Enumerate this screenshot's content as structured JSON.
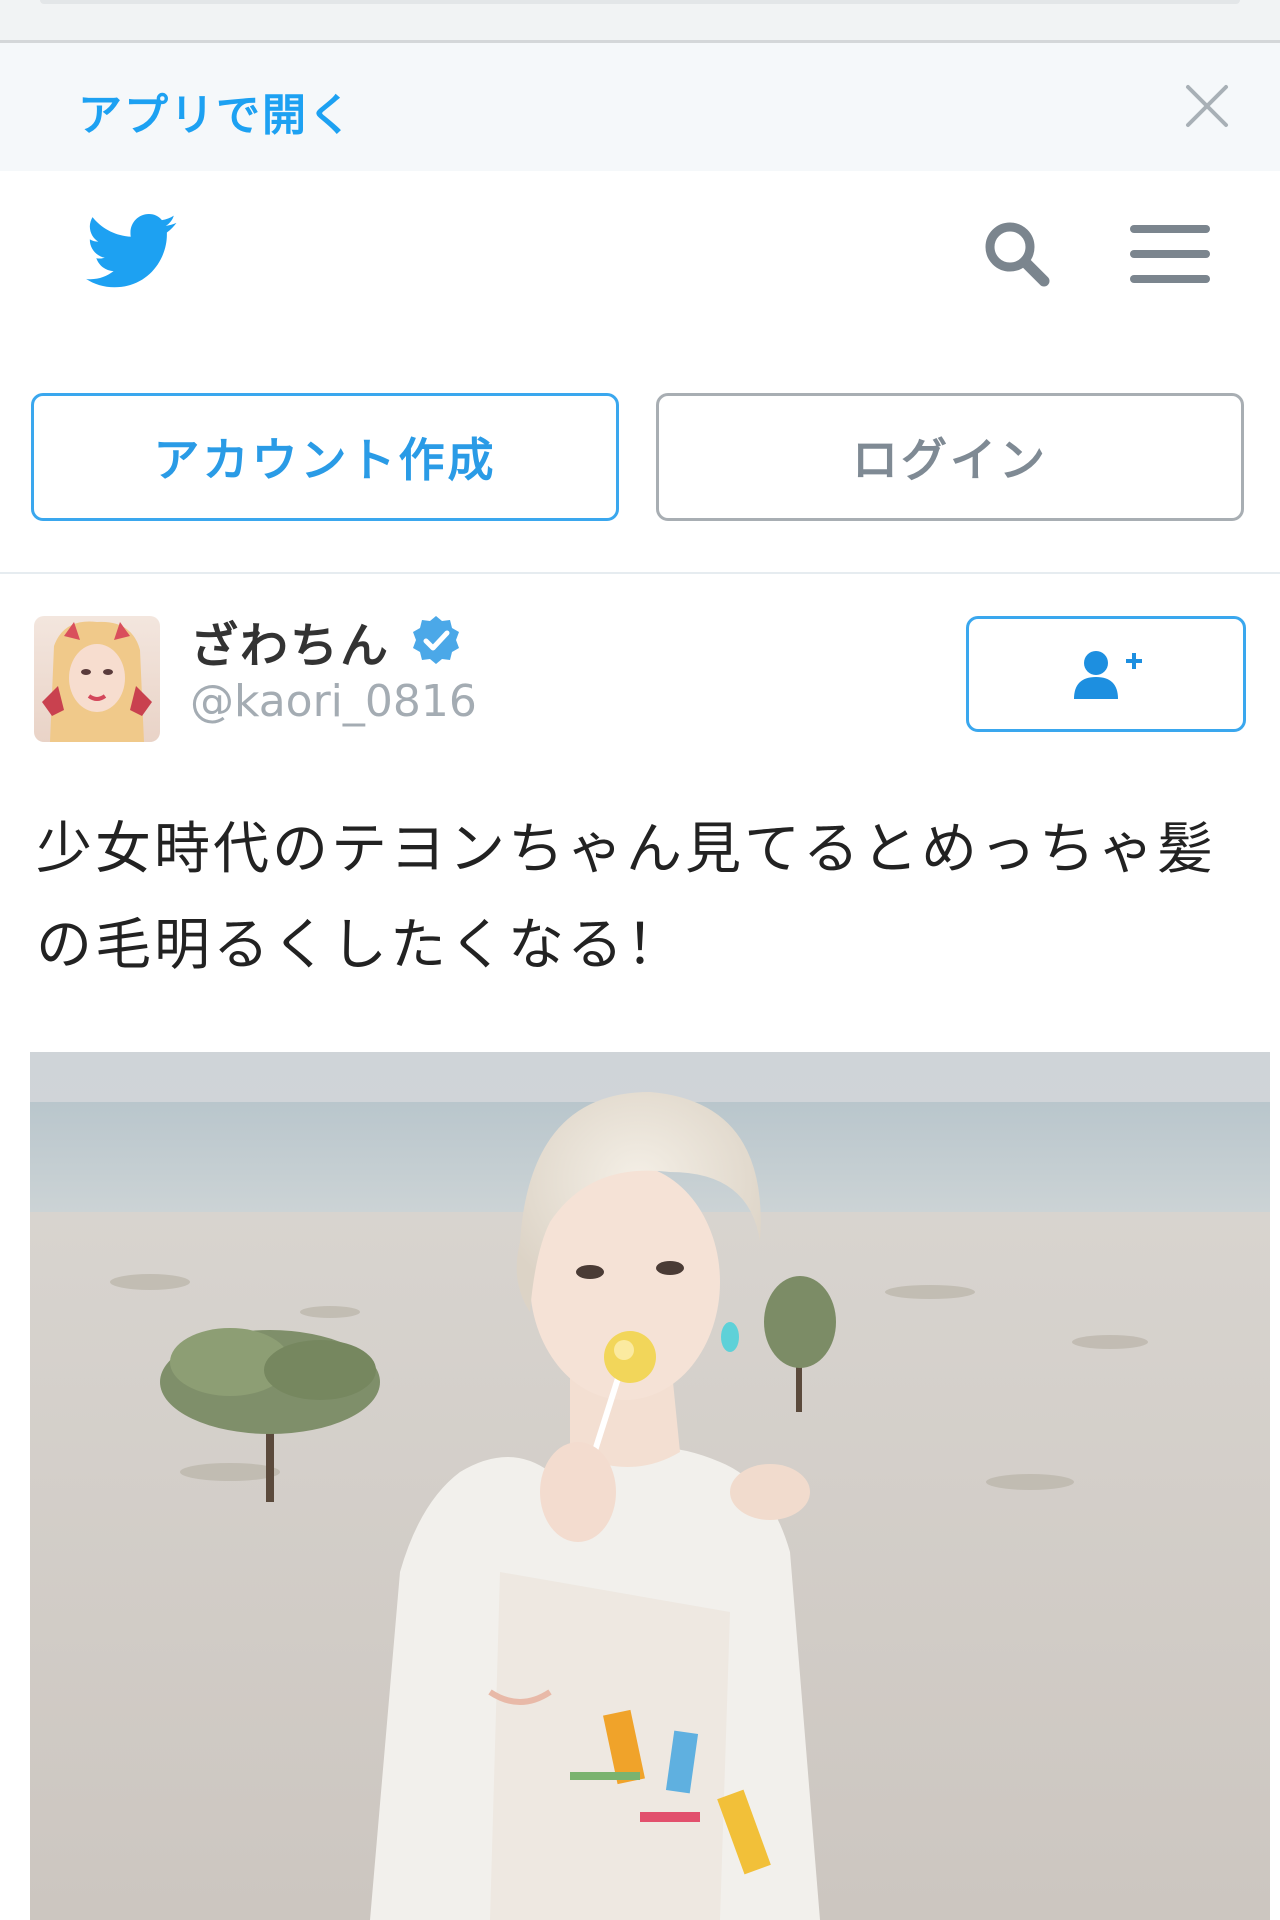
{
  "banner": {
    "open_in_app_label": "アプリで開く",
    "close_icon": "close-icon"
  },
  "navbar": {
    "logo_icon": "twitter-bird-icon",
    "search_icon": "search-icon",
    "menu_icon": "hamburger-menu-icon",
    "signup_label": "アカウント作成",
    "login_label": "ログイン"
  },
  "tweet": {
    "display_name": "ざわちん",
    "verified_icon": "verified-badge-icon",
    "handle": "@kaori_0816",
    "follow_icon": "follow-user-plus-icon",
    "text": "少女時代のテヨンちゃん見てるとめっちゃ髪の毛明るくしたくなる！",
    "photo_description_icon": "photo"
  },
  "colors": {
    "accent": "#1da1f2",
    "button_border": "#3aa7ee",
    "login_gray": "#7f8a94",
    "handle_gray": "#a4acb3",
    "background": "#f5f8fa"
  }
}
